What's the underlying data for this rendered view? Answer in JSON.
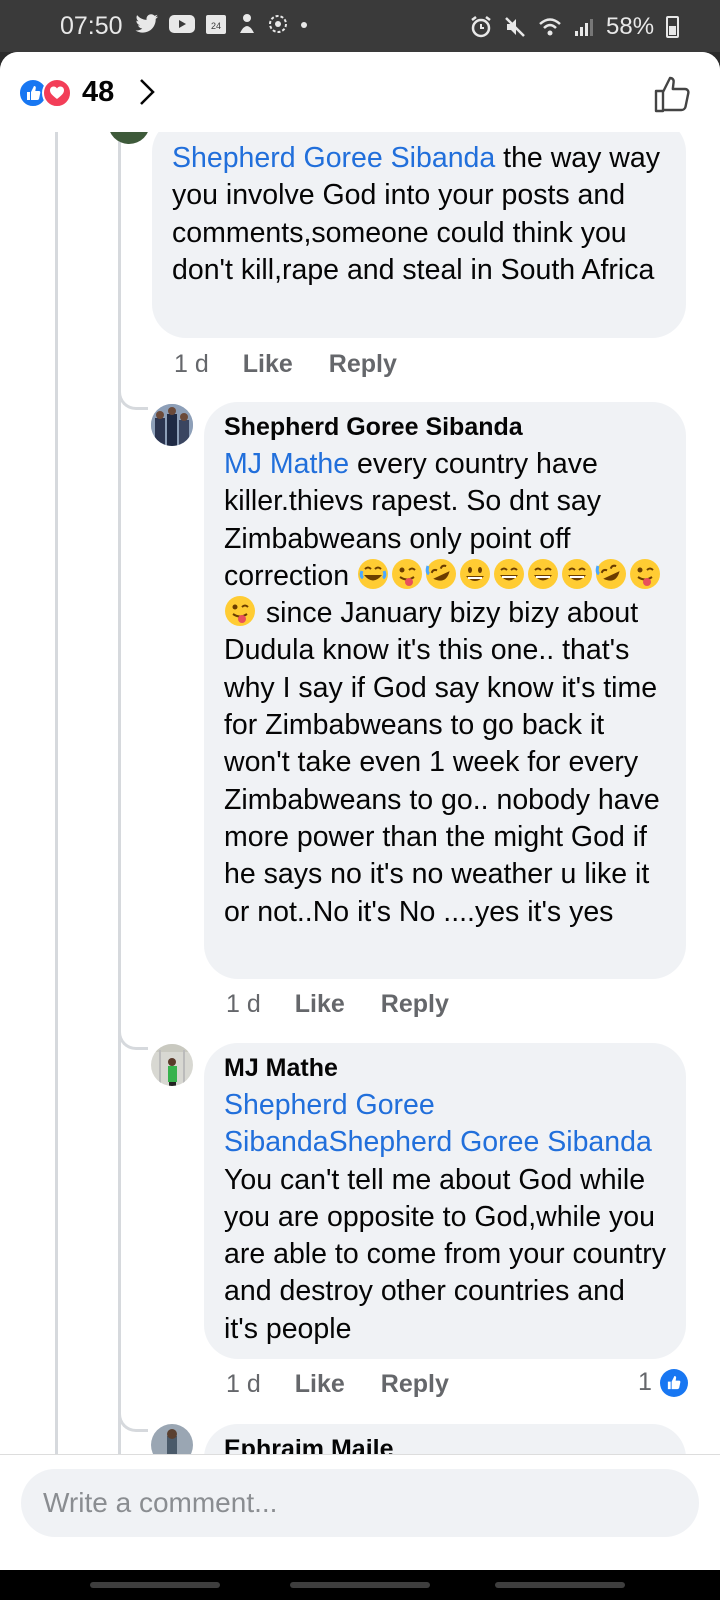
{
  "status_bar": {
    "time": "07:50",
    "battery": "58%",
    "left_icons": [
      "twitter-icon",
      "youtube-icon",
      "calendar-icon",
      "notification-icon",
      "settings-icon",
      "dot-icon"
    ],
    "right_icons": [
      "alarm-icon",
      "mute-icon",
      "wifi-icon",
      "signal-icon",
      "battery-icon"
    ]
  },
  "header": {
    "reaction_count": "48",
    "reactions": [
      "like",
      "love"
    ]
  },
  "comments": [
    {
      "mention": "Shepherd Goree Sibanda",
      "text": " the way way you involve God into your posts and comments,someone could think you don't kill,rape and steal in South Africa",
      "time": "1 d",
      "like_label": "Like",
      "reply_label": "Reply"
    },
    {
      "author": "Shepherd Goree Sibanda",
      "mention": "MJ Mathe",
      "text_before_emoji": "  every country have killer.thievs rapest. So dnt say Zimbabweans only point off correction ",
      "emojis": [
        "joy",
        "wink-tongue",
        "rofl",
        "grin",
        "smile",
        "smile",
        "smile",
        "rofl",
        "wink-tongue",
        "wink-tongue"
      ],
      "text_after_emoji": " since January bizy bizy about Dudula know it's this one.. that's why I say if God say know it's time for Zimbabweans to go back it won't take even 1 week for every Zimbabweans to go.. nobody have more power than the might God if he says no it's no weather u like it or not..No it's No ....yes it's yes",
      "time": "1 d",
      "like_label": "Like",
      "reply_label": "Reply"
    },
    {
      "author": "MJ Mathe",
      "mention_1": "Shepherd Goree",
      "mention_2": "SibandaShepherd Goree Sibanda",
      "text": "You can't tell me about God while you are opposite to God,while you are able to come from your country and destroy other countries and it's people",
      "time": "1 d",
      "like_label": "Like",
      "reply_label": "Reply",
      "reaction_count": "1"
    },
    {
      "author": "Ephraim Maile"
    }
  ],
  "composer": {
    "placeholder": "Write a comment..."
  },
  "colors": {
    "mention": "#216fdb",
    "bubble": "#f0f2f5",
    "like_blue": "#1877f2",
    "love_red": "#f33e58",
    "meta_gray": "#65676b"
  }
}
